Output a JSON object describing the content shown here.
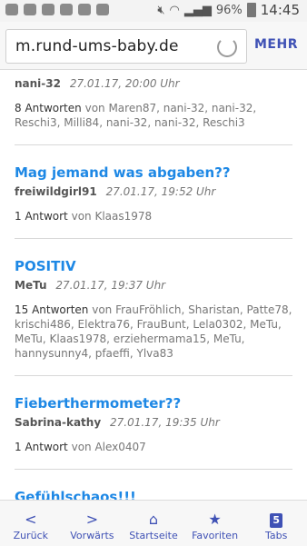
{
  "status": {
    "battery": "96%",
    "time": "14:45"
  },
  "browser": {
    "url": "m.rund-ums-baby.de",
    "menu_label": "MEHR"
  },
  "threads": [
    {
      "title": "",
      "author": "nani-32",
      "date": "27.01.17, 20:00 Uhr",
      "answers": "8 Antworten",
      "from": "von Maren87, nani-32, nani-32, Reschi3, Milli84, nani-32, nani-32, Reschi3"
    },
    {
      "title": "Mag jemand was abgaben??",
      "author": "freiwildgirl91",
      "date": "27.01.17, 19:52 Uhr",
      "answers": "1 Antwort",
      "from": "von Klaas1978"
    },
    {
      "title": "POSITIV",
      "author": "MeTu",
      "date": "27.01.17, 19:37 Uhr",
      "answers": "15 Antworten",
      "from": "von FrauFröhlich, Sharistan, Patte78, krischi486, Elektra76, FrauBunt, Lela0302, MeTu, MeTu, Klaas1978, erziehermama15, MeTu, hannysunny4, pfaeffi, Ylva83"
    },
    {
      "title": "Fieberthermometer??",
      "author": "Sabrina-kathy",
      "date": "27.01.17, 19:35 Uhr",
      "answers": "1 Antwort",
      "from": "von Alex0407"
    },
    {
      "title": "Gefühlschaos!!!",
      "author": "",
      "date": "",
      "answers": "",
      "from": ""
    }
  ],
  "bottom_nav": {
    "back": "Zurück",
    "forward": "Vorwärts",
    "home": "Startseite",
    "favorites": "Favoriten",
    "tabs": "Tabs",
    "tab_count": "5"
  }
}
